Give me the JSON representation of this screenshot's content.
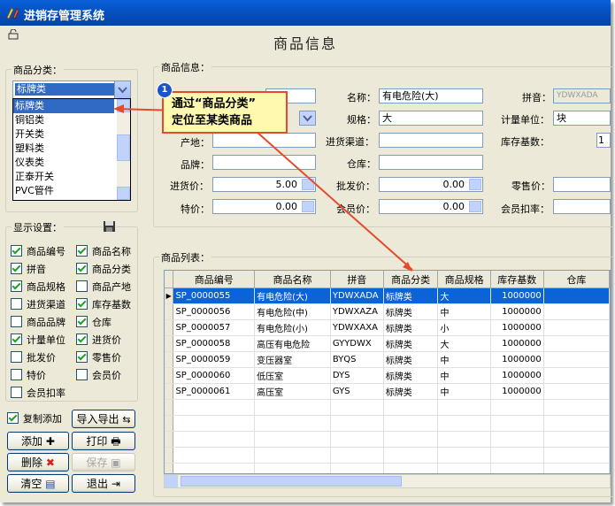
{
  "window": {
    "title": "进销存管理系统"
  },
  "page": {
    "title": "商品信息"
  },
  "category": {
    "group_label": "商品分类：",
    "selected": "标牌类",
    "options": [
      "标牌类",
      "铜铝类",
      "开关类",
      "塑料类",
      "仪表类",
      "正泰开关",
      "PVC管件"
    ]
  },
  "display_settings": {
    "group_label": "显示设置：",
    "items": [
      {
        "label": "商品编号",
        "checked": true
      },
      {
        "label": "商品名称",
        "checked": true
      },
      {
        "label": "拼音",
        "checked": true
      },
      {
        "label": "商品分类",
        "checked": true
      },
      {
        "label": "商品规格",
        "checked": true
      },
      {
        "label": "商品产地",
        "checked": false
      },
      {
        "label": "进货渠道",
        "checked": false
      },
      {
        "label": "库存基数",
        "checked": true
      },
      {
        "label": "商品品牌",
        "checked": false
      },
      {
        "label": "仓库",
        "checked": true
      },
      {
        "label": "计量单位",
        "checked": true
      },
      {
        "label": "进货价",
        "checked": true
      },
      {
        "label": "批发价",
        "checked": false
      },
      {
        "label": "零售价",
        "checked": true
      },
      {
        "label": "特价",
        "checked": false
      },
      {
        "label": "会员价",
        "checked": false
      },
      {
        "label": "会员扣率",
        "checked": false
      }
    ]
  },
  "copy_add": {
    "label": "复制添加",
    "checked": true
  },
  "buttons": {
    "import_export": "导入导出",
    "add": "添加",
    "print": "打印",
    "delete": "删除",
    "save": "保存",
    "clear": "清空",
    "exit": "退出"
  },
  "info": {
    "group_label": "商品信息：",
    "name_label": "名称：",
    "name_value": "有电危险(大)",
    "pinyin_label": "拼音：",
    "pinyin_value": "YDWXADA",
    "spec_label": "规格：",
    "spec_value": "大",
    "unit_label": "计量单位：",
    "unit_value": "块",
    "origin_label": "产地：",
    "channel_label": "进货渠道：",
    "stock_label": "库存基数：",
    "stock_value": "1",
    "brand_label": "品牌：",
    "warehouse_label": "仓库：",
    "purchase_label": "进货价：",
    "purchase_value": "5.00",
    "wholesale_label": "批发价：",
    "wholesale_value": "0.00",
    "retail_label": "零售价：",
    "special_label": "特价：",
    "special_value": "0.00",
    "member_label": "会员价：",
    "member_value": "0.00",
    "discount_label": "会员扣率："
  },
  "grid": {
    "group_label": "商品列表：",
    "columns": [
      "商品编号",
      "商品名称",
      "拼音",
      "商品分类",
      "商品规格",
      "库存基数",
      "仓库"
    ],
    "rows": [
      [
        "SP_0000055",
        "有电危险(大)",
        "YDWXADA",
        "标牌类",
        "大",
        "1000000",
        ""
      ],
      [
        "SP_0000056",
        "有电危险(中)",
        "YDWXAZA",
        "标牌类",
        "中",
        "1000000",
        ""
      ],
      [
        "SP_0000057",
        "有电危险(小)",
        "YDWXAXA",
        "标牌类",
        "小",
        "1000000",
        ""
      ],
      [
        "SP_0000058",
        "高压有电危险",
        "GYYDWX",
        "标牌类",
        "大",
        "1000000",
        ""
      ],
      [
        "SP_0000059",
        "变压器室",
        "BYQS",
        "标牌类",
        "中",
        "1000000",
        ""
      ],
      [
        "SP_0000060",
        "低压室",
        "DYS",
        "标牌类",
        "中",
        "1000000",
        ""
      ],
      [
        "SP_0000061",
        "高压室",
        "GYS",
        "标牌类",
        "中",
        "1000000",
        ""
      ]
    ]
  },
  "callout": {
    "badge": "1",
    "line1": "通过“商品分类”",
    "line2": "定位至某类商品"
  }
}
